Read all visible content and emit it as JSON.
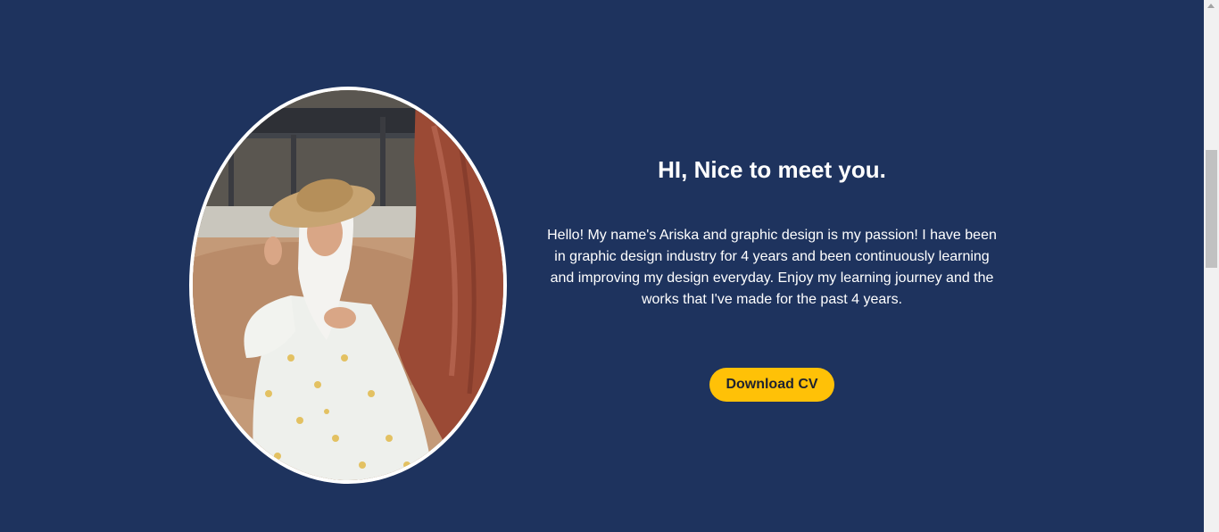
{
  "hero": {
    "heading": "HI, Nice to meet you.",
    "intro": "Hello! My name's Ariska and graphic design is my passion! I have been in graphic design industry for 4 years and been continuously learning and improving my design everyday. Enjoy my learning journey and the works that I've made for the past 4 years.",
    "cta_label": "Download CV",
    "portrait_alt": "Portrait photo of Ariska"
  },
  "colors": {
    "background": "#1e335e",
    "accent": "#ffc107",
    "text": "#ffffff"
  }
}
